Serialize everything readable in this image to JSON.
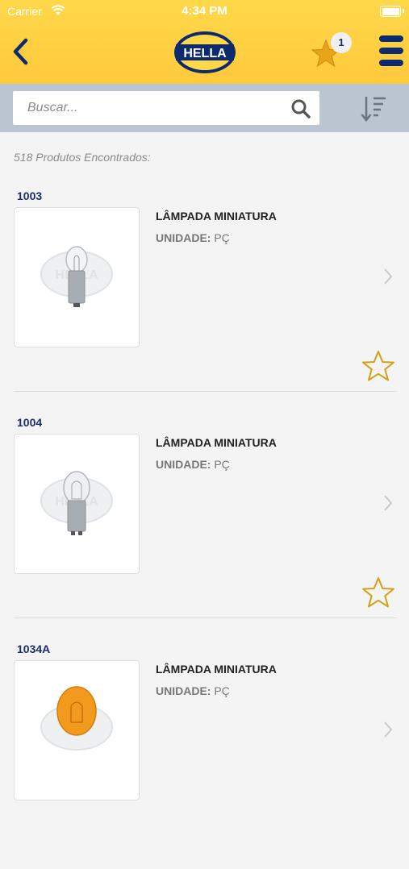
{
  "status": {
    "carrier": "Carrier",
    "time": "4:34 PM"
  },
  "header": {
    "logo_text": "HELLA",
    "favorites_count": "1"
  },
  "search": {
    "placeholder": "Buscar..."
  },
  "results": {
    "count_text": "518 Produtos Encontrados:"
  },
  "products": [
    {
      "code": "1003",
      "name": "LÂMPADA MINIATURA",
      "unit_label": "UNIDADE:",
      "unit_value": "PÇ",
      "bulb": "clear-single"
    },
    {
      "code": "1004",
      "name": "LÂMPADA MINIATURA",
      "unit_label": "UNIDADE:",
      "unit_value": "PÇ",
      "bulb": "clear-double"
    },
    {
      "code": "1034A",
      "name": "LÂMPADA MINIATURA",
      "unit_label": "UNIDADE:",
      "unit_value": "PÇ",
      "bulb": "amber"
    }
  ],
  "colors": {
    "header": "#ffc93c",
    "navy": "#0c2a6e",
    "star_gold": "#e8a51a",
    "search_bg": "#bcc6d0"
  },
  "icons": [
    "wifi-icon",
    "battery-icon",
    "back-icon",
    "star-filled-icon",
    "menu-icon",
    "search-icon",
    "sort-icon",
    "chevron-right-icon",
    "star-outline-icon"
  ]
}
